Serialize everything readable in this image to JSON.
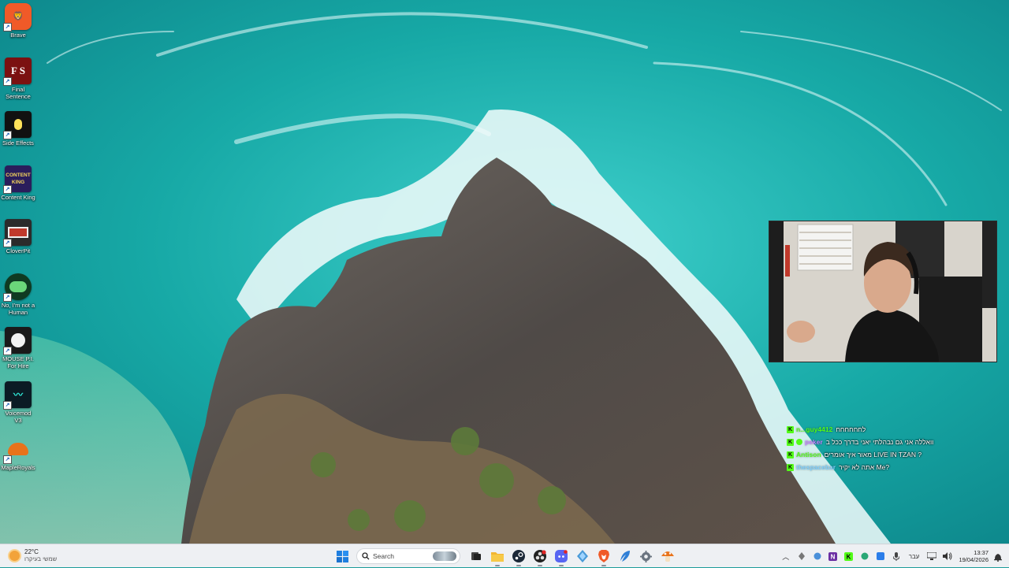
{
  "desktop": {
    "icons": [
      {
        "label": "Brave",
        "icon": "brave-lion-icon",
        "color": "#f05a28"
      },
      {
        "label": "Final Sentence",
        "icon": "final-sentence-icon",
        "color": "#7b1111"
      },
      {
        "label": "Side Effects",
        "icon": "side-effects-pill-icon",
        "color": "#111111"
      },
      {
        "label": "Content King",
        "icon": "content-king-icon",
        "color": "#2a1d5c"
      },
      {
        "label": "CloverPit",
        "icon": "cloverpit-slot-icon",
        "color": "#2b2b2b"
      },
      {
        "label": "No, I'm not a Human",
        "icon": "not-human-icon",
        "color": "#0f3a22"
      },
      {
        "label": "MOUSE P.I. For Hire",
        "icon": "mouse-pi-icon",
        "color": "#1a1a1a"
      },
      {
        "label": "Voicemod V3",
        "icon": "voicemod-icon",
        "color": "#0b1b24"
      },
      {
        "label": "MapleRoyals",
        "icon": "mushroom-icon",
        "color": "#e8731b"
      }
    ]
  },
  "chat": {
    "messages": [
      {
        "user": "n...guy4412",
        "text": "לחחחחחח",
        "user_color": "#53fc18"
      },
      {
        "user": "peker",
        "text": "וואללה אני גם נבהלתי יאני בדרך ככל ב",
        "user_color": "#c47cff"
      },
      {
        "user": "Antison",
        "text": "מאור איך אומרים LIVE IN TZAN ?",
        "user_color": "#53fc18"
      },
      {
        "user": "thespacebar",
        "text": "אתה לא יקיר Me?",
        "user_color": "#7fd0ff"
      }
    ]
  },
  "taskbar": {
    "weather": {
      "temp": "22°C",
      "desc": "שמשי בעיקרו"
    },
    "search": {
      "placeholder": "Search"
    },
    "apps": [
      {
        "name": "start",
        "icon": "windows-start-icon"
      },
      {
        "name": "search",
        "icon": "search-icon"
      },
      {
        "name": "task-view",
        "icon": "task-view-icon"
      },
      {
        "name": "file-explorer",
        "icon": "folder-icon"
      },
      {
        "name": "steam",
        "icon": "steam-icon"
      },
      {
        "name": "obs",
        "icon": "obs-icon"
      },
      {
        "name": "discord",
        "icon": "discord-icon"
      },
      {
        "name": "app-diamond",
        "icon": "diamond-app-icon"
      },
      {
        "name": "brave",
        "icon": "brave-icon"
      },
      {
        "name": "feather-app",
        "icon": "feather-icon"
      },
      {
        "name": "settings",
        "icon": "gear-icon"
      },
      {
        "name": "mapleroyals",
        "icon": "mushroom-icon"
      }
    ],
    "tray": {
      "language": "עבר",
      "time": "13:37",
      "date": "19/04/2026"
    }
  }
}
